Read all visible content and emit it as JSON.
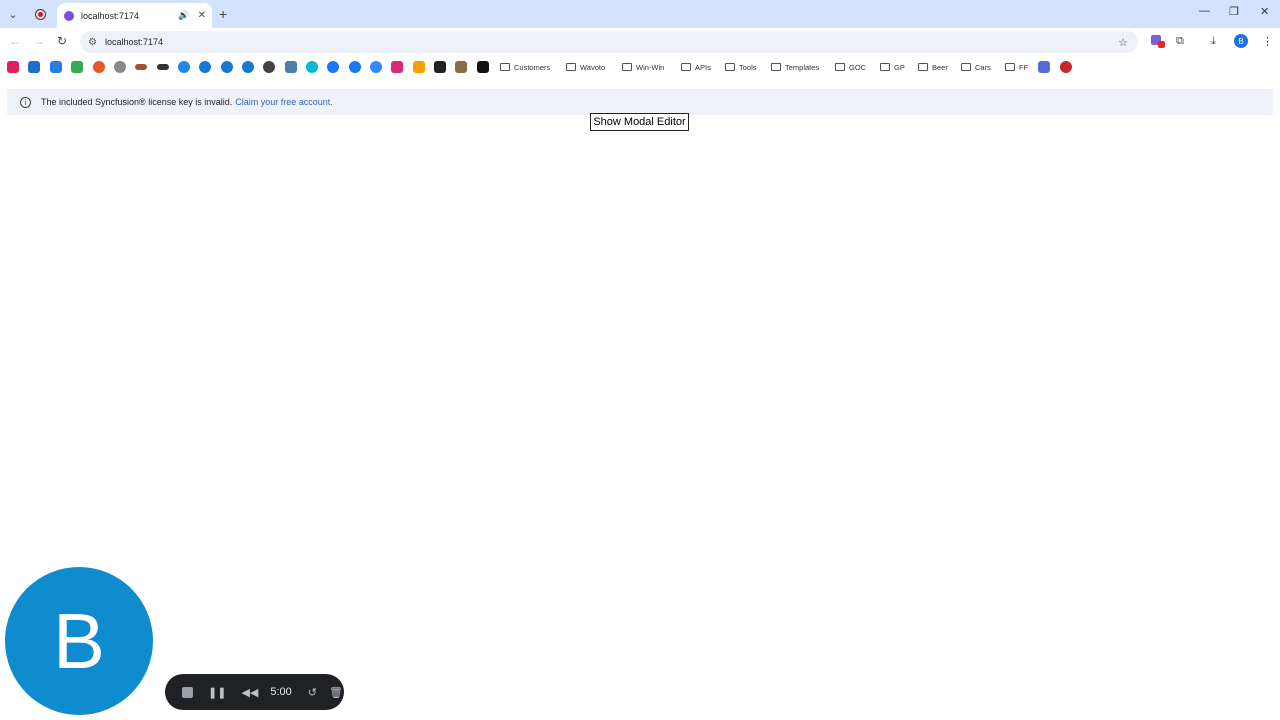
{
  "browser": {
    "tab_title": "localhost:7174",
    "url": "localhost:7174",
    "profile_initial": "B",
    "bookmarks_folders": [
      "Customers",
      "Wavoto",
      "Win-Win",
      "APIs",
      "Tools",
      "Templates",
      "GOC",
      "GP",
      "Beer",
      "Cars",
      "FF"
    ]
  },
  "banner": {
    "message": "The included Syncfusion® license key is invalid.",
    "link": "Claim your free account."
  },
  "main": {
    "button_label": "Show Modal Editor"
  },
  "overlay": {
    "avatar_letter": "B",
    "timer": "5:00"
  }
}
